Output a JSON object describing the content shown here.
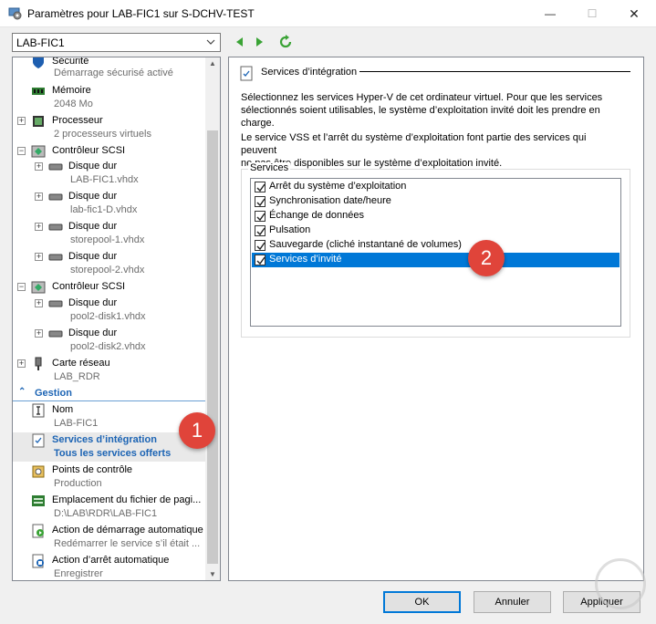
{
  "window": {
    "title": "Paramètres pour LAB-FIC1 sur S-DCHV-TEST"
  },
  "vm_selector": {
    "value": "LAB-FIC1"
  },
  "tree": {
    "rows": [
      {
        "label": "Sécurité",
        "sub": "Démarrage sécurisé activé"
      },
      {
        "label": "Mémoire",
        "sub": "2048 Mo"
      },
      {
        "label": "Processeur",
        "sub": "2 processeurs virtuels"
      },
      {
        "label": "Contrôleur SCSI"
      },
      {
        "label": "Disque dur",
        "sub": "LAB-FIC1.vhdx"
      },
      {
        "label": "Disque dur",
        "sub": "lab-fic1-D.vhdx"
      },
      {
        "label": "Disque dur",
        "sub": "storepool-1.vhdx"
      },
      {
        "label": "Disque dur",
        "sub": "storepool-2.vhdx"
      },
      {
        "label": "Contrôleur SCSI"
      },
      {
        "label": "Disque dur",
        "sub": "pool2-disk1.vhdx"
      },
      {
        "label": "Disque dur",
        "sub": "pool2-disk2.vhdx"
      },
      {
        "label": "Carte réseau",
        "sub": "LAB_RDR"
      }
    ],
    "section_gestion": "Gestion",
    "gestion": [
      {
        "label": "Nom",
        "sub": "LAB-FIC1"
      },
      {
        "label": "Services d’intégration",
        "sub": "Tous les services offerts"
      },
      {
        "label": "Points de contrôle",
        "sub": "Production"
      },
      {
        "label": "Emplacement du fichier de pagi...",
        "sub": "D:\\LAB\\RDR\\LAB-FIC1"
      },
      {
        "label": "Action de démarrage automatique",
        "sub": "Redémarrer le service s’il était ..."
      },
      {
        "label": "Action d’arrêt automatique",
        "sub": "Enregistrer"
      }
    ]
  },
  "panel": {
    "title": "Services d’intégration",
    "para1_line1": "Sélectionnez les services Hyper-V de cet ordinateur virtuel. Pour que les services",
    "para1_line2": "sélectionnés soient utilisables, le système d’exploitation invité doit les prendre en",
    "para1_line3": "charge.",
    "para2_line1": "Le service VSS et l’arrêt du système d’exploitation font partie des services qui peuvent",
    "para2_line2": "ne pas être disponibles sur le système d’exploitation invité.",
    "group_label": "Services",
    "services": [
      {
        "label": "Arrêt du système d’exploitation",
        "checked": true
      },
      {
        "label": "Synchronisation date/heure",
        "checked": true
      },
      {
        "label": "Échange de données",
        "checked": true
      },
      {
        "label": "Pulsation",
        "checked": true
      },
      {
        "label": "Sauvegarde (cliché instantané de volumes)",
        "checked": true
      },
      {
        "label": "Services d’invité",
        "checked": true
      }
    ]
  },
  "buttons": {
    "ok": "OK",
    "cancel": "Annuler",
    "apply": "Appliquer"
  },
  "callouts": {
    "one": "1",
    "two": "2"
  },
  "colors": {
    "accent": "#0078d7",
    "section": "#1c64b4",
    "callout": "#e0443a"
  }
}
